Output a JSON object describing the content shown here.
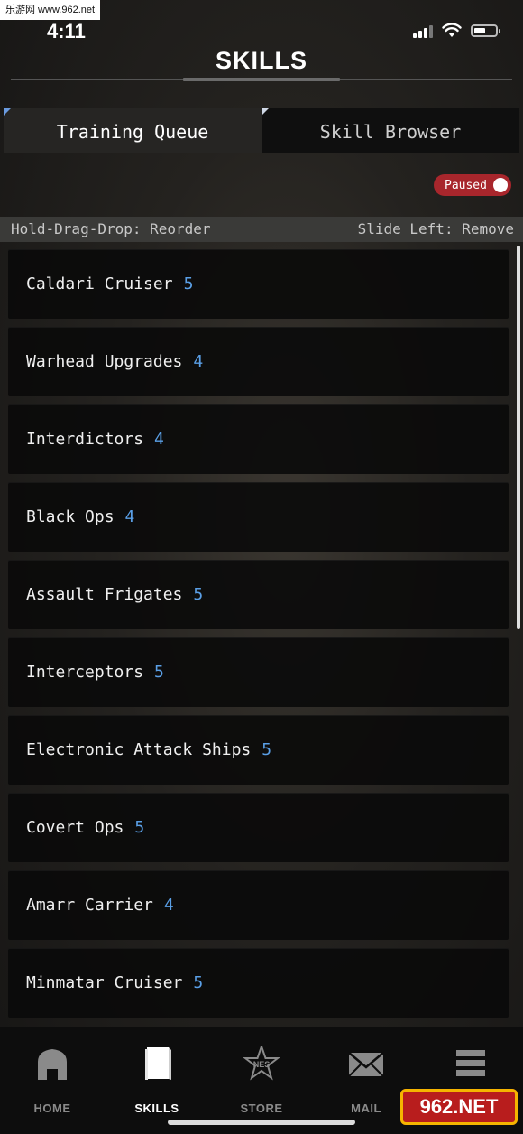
{
  "watermark": {
    "text": "乐游网 www.962.net"
  },
  "status_bar": {
    "time": "4:11"
  },
  "header": {
    "title": "SKILLS"
  },
  "tabs": [
    {
      "label": "Training Queue",
      "active": true
    },
    {
      "label": "Skill Browser",
      "active": false
    }
  ],
  "queue_toggle": {
    "label": "Paused",
    "state": "paused"
  },
  "hints": {
    "left": "Hold-Drag-Drop: Reorder",
    "right": "Slide Left: Remove"
  },
  "queue": [
    {
      "name": "Caldari Cruiser",
      "level": "5"
    },
    {
      "name": "Warhead Upgrades",
      "level": "4"
    },
    {
      "name": "Interdictors",
      "level": "4"
    },
    {
      "name": "Black Ops",
      "level": "4"
    },
    {
      "name": "Assault Frigates",
      "level": "5"
    },
    {
      "name": "Interceptors",
      "level": "5"
    },
    {
      "name": "Electronic Attack Ships",
      "level": "5"
    },
    {
      "name": "Covert Ops",
      "level": "5"
    },
    {
      "name": "Amarr Carrier",
      "level": "4"
    },
    {
      "name": "Minmatar Cruiser",
      "level": "5"
    }
  ],
  "nav": [
    {
      "label": "HOME",
      "icon": "home-icon"
    },
    {
      "label": "SKILLS",
      "icon": "book-icon",
      "active": true
    },
    {
      "label": "STORE",
      "icon": "nes-star-icon"
    },
    {
      "label": "MAIL",
      "icon": "envelope-icon"
    },
    {
      "label": "",
      "icon": "menu-icon"
    }
  ],
  "corner_badge": {
    "text": "962.NET"
  },
  "colors": {
    "accent": "#5a9fe6",
    "paused": "#a8262c"
  }
}
